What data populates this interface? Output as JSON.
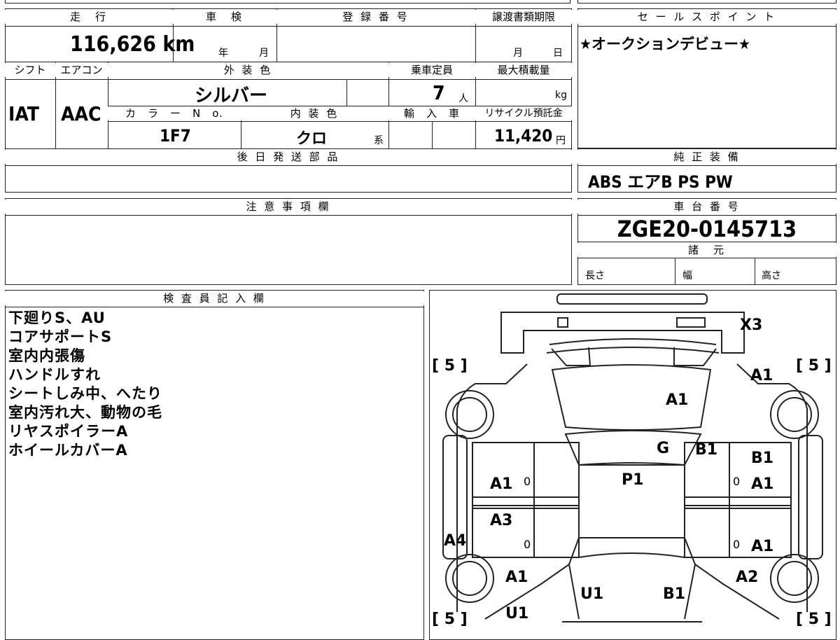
{
  "top_left": {
    "headers": {
      "mileage": "走　行",
      "inspection": "車　検",
      "registration": "登 録 番 号",
      "transfer_deadline": "譲渡書類期限",
      "shift": "シフト",
      "aircon": "エアコン",
      "exterior_color": "外 装 色",
      "capacity": "乗車定員",
      "max_load": "最大積載量",
      "color_no": "カ　ラ　ー　N　o.",
      "interior_color": "内 装 色",
      "import": "輸　入　車",
      "recycle_fee": "リサイクル預託金",
      "later_parts": "後 日 発 送 部 品"
    },
    "values": {
      "mileage": "116,626 km",
      "inspection_year_unit": "年",
      "inspection_month_unit": "月",
      "transfer_month_unit": "月",
      "transfer_day_unit": "日",
      "shift": "IAT",
      "aircon": "AAC",
      "exterior_color": "シルバー",
      "capacity": "7",
      "capacity_unit": "人",
      "max_load_unit": "kg",
      "color_no": "1F7",
      "interior_color": "クロ",
      "interior_suffix": "系",
      "recycle_fee": "11,420",
      "recycle_unit": "円"
    }
  },
  "sales_point": {
    "header": "セ ー ル ス ポ イ ン ト",
    "text": "★オークションデビュー★"
  },
  "standard_equipment": {
    "header": "純 正 装 備",
    "text": "ABS エアB PS PW"
  },
  "caution": {
    "header": "注 意 事 項 欄"
  },
  "chassis": {
    "header": "車 台 番 号",
    "number": "ZGE20-0145713",
    "specs_header": "諸　元",
    "length": "長さ",
    "width": "幅",
    "height": "高さ"
  },
  "inspector": {
    "header": "検 査 員 記 入 欄",
    "lines": [
      "下廻りS、AU",
      "コアサポートS",
      "室内内張傷",
      "ハンドルすれ",
      "シートしみ中、へたり",
      "室内汚れ大、動物の毛",
      "リヤスポイラーA",
      "ホイールカバーA"
    ]
  },
  "diagram": {
    "marks": {
      "x3": "X3",
      "fl_fender": "A1",
      "hood": "A1",
      "windshield": "G",
      "roof_right": "B1",
      "right_fender": "B1",
      "roof": "P1",
      "left_front_door": "A1",
      "right_front_door": "A1",
      "left_rear_door": "A3",
      "left_rocker": "A4",
      "right_rear_door": "A1",
      "left_quarter": "A1",
      "right_quarter": "A2",
      "trunk_left": "U1",
      "trunk_right": "B1",
      "rear_left": "U1",
      "zero1": "0",
      "zero2": "0",
      "zero3": "0",
      "zero4": "0"
    },
    "tires": {
      "front_left": "[ 5 ]",
      "front_right": "[ 5 ]",
      "rear_left": "[ 5 ]",
      "rear_right": "[ 5 ]"
    }
  }
}
